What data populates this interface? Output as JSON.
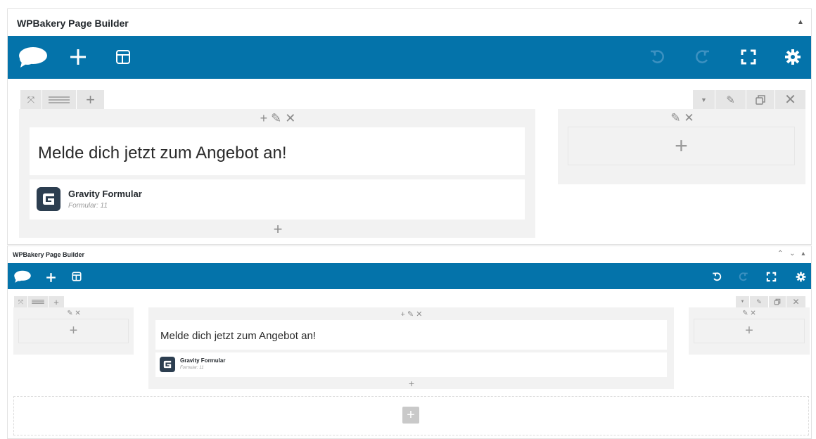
{
  "top_panel": {
    "title": "WPBakery Page Builder",
    "toggle_icon": "triangle-up-icon",
    "toolbar_icons": [
      "speech-bubble-logo-icon",
      "plus-icon",
      "layout-icon"
    ],
    "toolbar_right_icons": [
      "undo-icon",
      "redo-icon",
      "fullscreen-icon",
      "gear-icon"
    ],
    "row_controls": [
      "move-icon",
      "columns-icon",
      "plus-icon"
    ],
    "row_controls_right": [
      "caret-down-icon",
      "pencil-icon",
      "clone-icon",
      "close-icon"
    ],
    "column_left": {
      "controls": "+ ✎ ✕",
      "heading": "Melde dich jetzt zum Angebot an!",
      "form_name": "Gravity Formular",
      "form_sub": "Formular: 11",
      "add": "+"
    },
    "column_right": {
      "controls": "✎ ✕",
      "add": "+"
    }
  },
  "bottom_panel": {
    "title": "WPBakery Page Builder",
    "header_arrows": "⌃ ⌄ ▴",
    "column_1": {
      "controls": "✎ ✕",
      "add": "+"
    },
    "column_2": {
      "controls": "+ ✎ ✕",
      "heading": "Melde dich jetzt zum Angebot an!",
      "form_name": "Gravity Formular",
      "form_sub": "Formular: 11",
      "add": "+"
    },
    "column_3": {
      "controls": "✎ ✕",
      "add": "+"
    },
    "add_row": "+"
  },
  "colors": {
    "toolbar": "#0473aa",
    "column_bg": "#f2f2f2",
    "control_bg": "#e6e6e6"
  }
}
